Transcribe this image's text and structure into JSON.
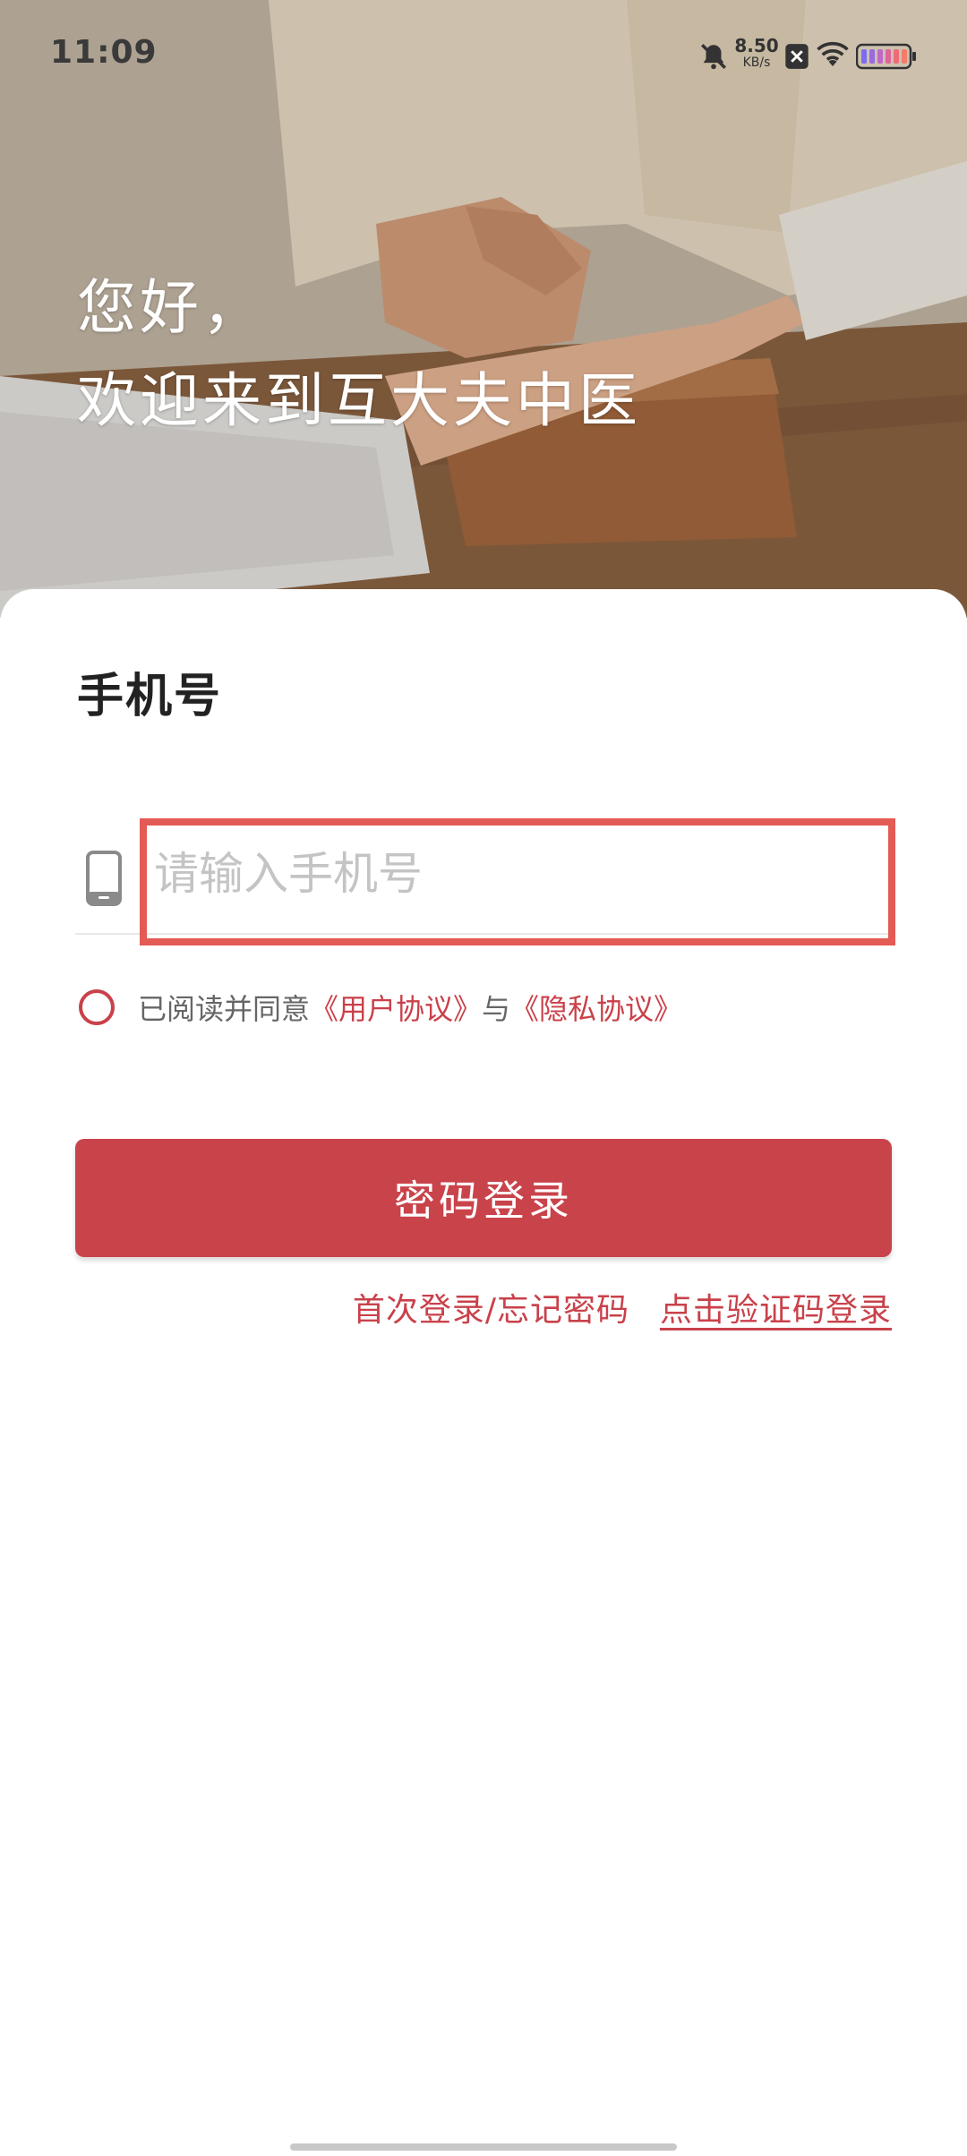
{
  "status_bar": {
    "time": "11:09",
    "net_speed_value": "8.50",
    "net_speed_unit": "KB/s",
    "icons": [
      "mute-bell-icon",
      "notification-icon",
      "wifi-icon",
      "battery-icon"
    ]
  },
  "hero": {
    "greeting_line1": "您好，",
    "greeting_line2": "欢迎来到互大夫中医"
  },
  "form": {
    "section_title": "手机号",
    "phone_placeholder": "请输入手机号",
    "agreement_prefix": "已阅读并同意",
    "user_agreement": "《用户协议》",
    "agreement_and": "与",
    "privacy_agreement": "《隐私协议》",
    "login_button": "密码登录",
    "first_login_link": "首次登录/忘记密码",
    "sms_login_link": "点击验证码登录"
  },
  "colors": {
    "accent": "#c9434b",
    "highlight_box": "#e45a55"
  }
}
